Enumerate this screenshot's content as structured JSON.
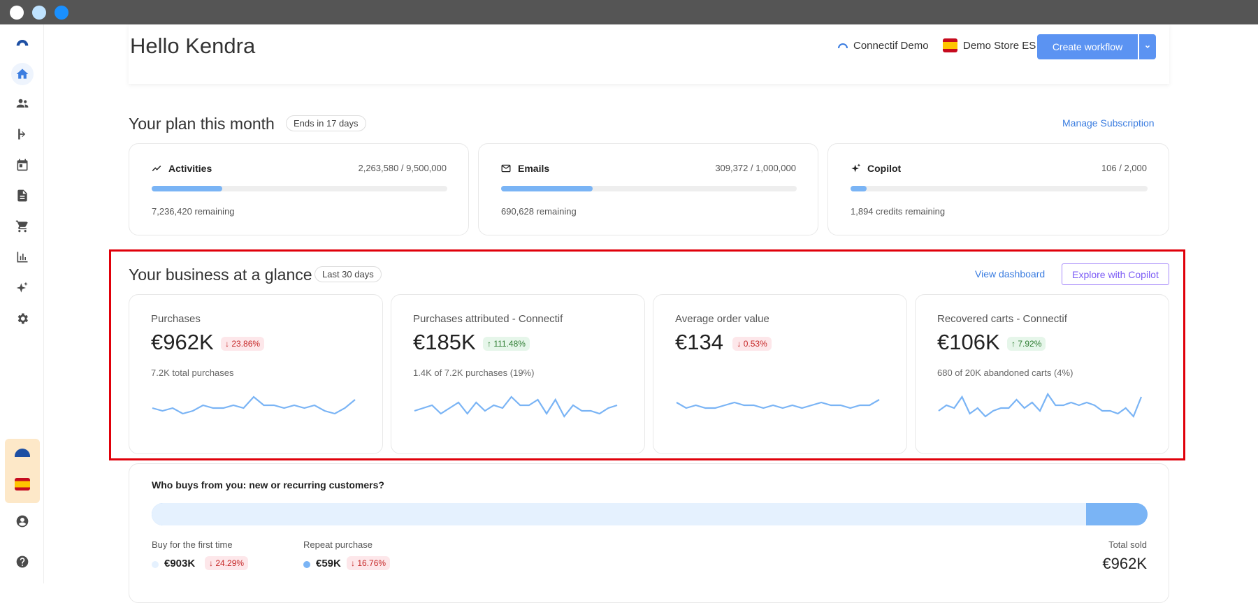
{
  "colors": {
    "accent": "#4d8ef5",
    "spark": "#7ab4f5",
    "highlight": "#e0000a"
  },
  "header": {
    "greeting": "Hello Kendra",
    "account": "Connectif Demo",
    "store": "Demo Store ES",
    "create_button": "Create workflow"
  },
  "plan": {
    "title": "Your plan this month",
    "badge": "Ends in 17 days",
    "manage_link": "Manage Subscription",
    "cards": [
      {
        "icon": "trend-icon",
        "name": "Activities",
        "usage": "2,263,580 / 9,500,000",
        "remaining": "7,236,420 remaining",
        "progress": 0.238
      },
      {
        "icon": "mail-icon",
        "name": "Emails",
        "usage": "309,372 / 1,000,000",
        "remaining": "690,628 remaining",
        "progress": 0.309
      },
      {
        "icon": "sparkle-icon",
        "name": "Copilot",
        "usage": "106 / 2,000",
        "remaining": "1,894 credits remaining",
        "progress": 0.053
      }
    ]
  },
  "business": {
    "title": "Your business at a glance",
    "badge": "Last 30 days",
    "view_dashboard": "View dashboard",
    "explore_button": "Explore with Copilot",
    "kpis": [
      {
        "title": "Purchases",
        "value": "€962K",
        "change": "23.86%",
        "direction": "down",
        "sub": "7.2K total purchases",
        "spark": [
          5,
          4,
          5,
          3,
          4,
          6,
          5,
          5,
          6,
          5,
          9,
          6,
          6,
          5,
          6,
          5,
          6,
          4,
          3,
          5,
          8
        ]
      },
      {
        "title": "Purchases attributed - Connectif",
        "value": "€185K",
        "change": "111.48%",
        "direction": "up",
        "sub": "1.4K of 7.2K purchases (19%)",
        "spark": [
          4,
          5,
          6,
          3,
          5,
          7,
          3,
          7,
          4,
          6,
          5,
          9,
          6,
          6,
          8,
          3,
          8,
          2,
          6,
          4,
          4,
          3,
          5,
          6
        ]
      },
      {
        "title": "Average order value",
        "value": "€134",
        "change": "0.53%",
        "direction": "down",
        "sub": "",
        "spark": [
          7,
          5,
          6,
          5,
          5,
          6,
          7,
          6,
          6,
          5,
          6,
          5,
          6,
          5,
          6,
          7,
          6,
          6,
          5,
          6,
          6,
          8
        ]
      },
      {
        "title": "Recovered carts - Connectif",
        "value": "€106K",
        "change": "7.92%",
        "direction": "up",
        "sub": "680 of 20K abandoned carts (4%)",
        "spark": [
          4,
          6,
          5,
          9,
          3,
          5,
          2,
          4,
          5,
          5,
          8,
          5,
          7,
          4,
          10,
          6,
          6,
          7,
          6,
          7,
          6,
          4,
          4,
          3,
          5,
          2,
          9
        ]
      }
    ]
  },
  "customers": {
    "title": "Who buys from you: new or recurring customers?",
    "new_share": 0.938,
    "first": {
      "label": "Buy for the first time",
      "value": "€903K",
      "change": "24.29%",
      "direction": "down"
    },
    "repeat": {
      "label": "Repeat purchase",
      "value": "€59K",
      "change": "16.76%",
      "direction": "down"
    },
    "total": {
      "label": "Total sold",
      "value": "€962K"
    }
  }
}
